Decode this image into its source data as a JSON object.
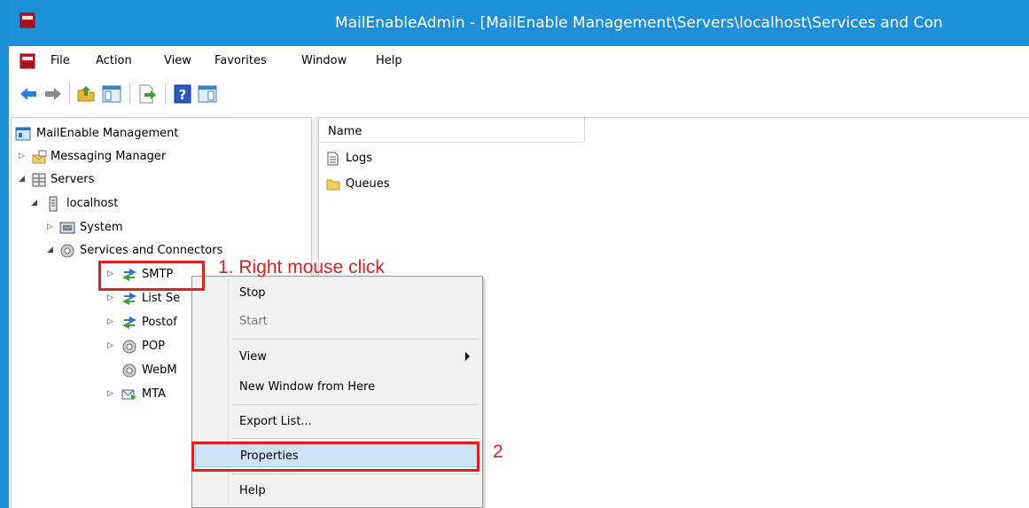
{
  "window": {
    "title": "MailEnableAdmin - [MailEnable Management\\Servers\\localhost\\Services and Con",
    "app_icon": "mailenable-icon",
    "accent_color": "#1e90d9"
  },
  "menubar": {
    "items": [
      "File",
      "Action",
      "View",
      "Favorites",
      "Window",
      "Help"
    ]
  },
  "toolbar": {
    "buttons": [
      "back-arrow-icon",
      "forward-arrow-icon",
      "up-folder-icon",
      "show-hide-tree-icon",
      "export-list-icon",
      "help-icon",
      "show-hide-action-pane-icon"
    ]
  },
  "tree": {
    "items": [
      {
        "label": "MailEnable Management",
        "icon": "management-console-icon"
      },
      {
        "label": "Messaging Manager",
        "icon": "mail-envelope-icon"
      },
      {
        "label": "Servers",
        "icon": "servers-icon"
      },
      {
        "label": "localhost",
        "icon": "server-icon"
      },
      {
        "label": "System",
        "icon": "system-icon"
      },
      {
        "label": "Services and Connectors",
        "icon": "gear-icon"
      },
      {
        "label": "SMTP",
        "icon": "connector-arrows-icon"
      },
      {
        "label": "List Se",
        "icon": "connector-arrows-icon"
      },
      {
        "label": "Postof",
        "icon": "connector-arrows-icon"
      },
      {
        "label": "POP",
        "icon": "gear-icon"
      },
      {
        "label": "WebM",
        "icon": "gear-icon"
      },
      {
        "label": "MTA",
        "icon": "mta-envelope-icon"
      }
    ]
  },
  "list": {
    "column_header": "Name",
    "items": [
      {
        "label": "Logs",
        "icon": "document-icon"
      },
      {
        "label": "Queues",
        "icon": "folder-icon"
      }
    ]
  },
  "context_menu": {
    "items": [
      "Stop",
      "Start",
      "View",
      "New Window from Here",
      "Export List...",
      "Properties",
      "Help"
    ],
    "disabled": [
      "Start"
    ],
    "highlighted": "Properties"
  },
  "annotations": {
    "step1": "1. Right mouse click",
    "step2": "2",
    "color": "#e02020"
  }
}
